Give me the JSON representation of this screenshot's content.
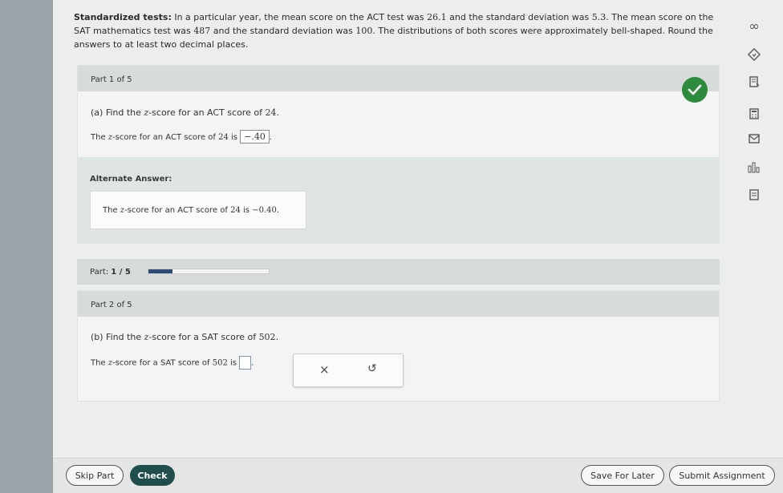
{
  "problem": {
    "title": "Standardized tests:",
    "text_1": " In a particular year, the mean score on the ACT test was ",
    "act_mean": "26.1",
    "text_2": " and the standard deviation was ",
    "act_sd": "5.3",
    "text_3": ". The mean score on the SAT mathematics test was ",
    "sat_mean": "487",
    "text_4": " and the standard deviation was ",
    "sat_sd": "100",
    "text_5": ". The distributions of both scores were approximately bell-shaped. Round the answers to at least two decimal places."
  },
  "part1": {
    "header": "Part 1 of 5",
    "question_prefix": "(a) Find the ",
    "z": "z",
    "question_suffix": "-score for an ACT score of ",
    "question_value": "24",
    "question_end": ".",
    "answer_prefix": "The ",
    "answer_mid": "-score for an ACT score of ",
    "answer_score": "24",
    "answer_is": " is ",
    "answer_value": "−.40",
    "answer_end": "."
  },
  "alternate": {
    "title": "Alternate Answer:",
    "prefix": "The ",
    "mid": "-score for an ACT score of ",
    "score": "24",
    "is": " is ",
    "value": "−0.40",
    "end": "."
  },
  "progress": {
    "label_prefix": "Part: ",
    "label_value": "1 / 5",
    "fraction": 0.2,
    "color": "#2d4b7a"
  },
  "part2": {
    "header": "Part 2 of 5",
    "question_prefix": "(b) Find the ",
    "question_suffix": "-score for a SAT score of ",
    "question_value": "502",
    "question_end": ".",
    "answer_prefix": "The ",
    "answer_mid": "-score for a SAT score of ",
    "answer_score": "502",
    "answer_is": " is ",
    "answer_end": ".",
    "clear_symbol": "×",
    "undo_symbol": "↺"
  },
  "buttons": {
    "skip": "Skip Part",
    "check": "Check",
    "save": "Save For Later",
    "submit": "Submit Assignment"
  },
  "rail_icons": {
    "infinity": "∞"
  },
  "colors": {
    "check_badge": "#2e8b3d",
    "check_button": "#1f4e4d"
  }
}
